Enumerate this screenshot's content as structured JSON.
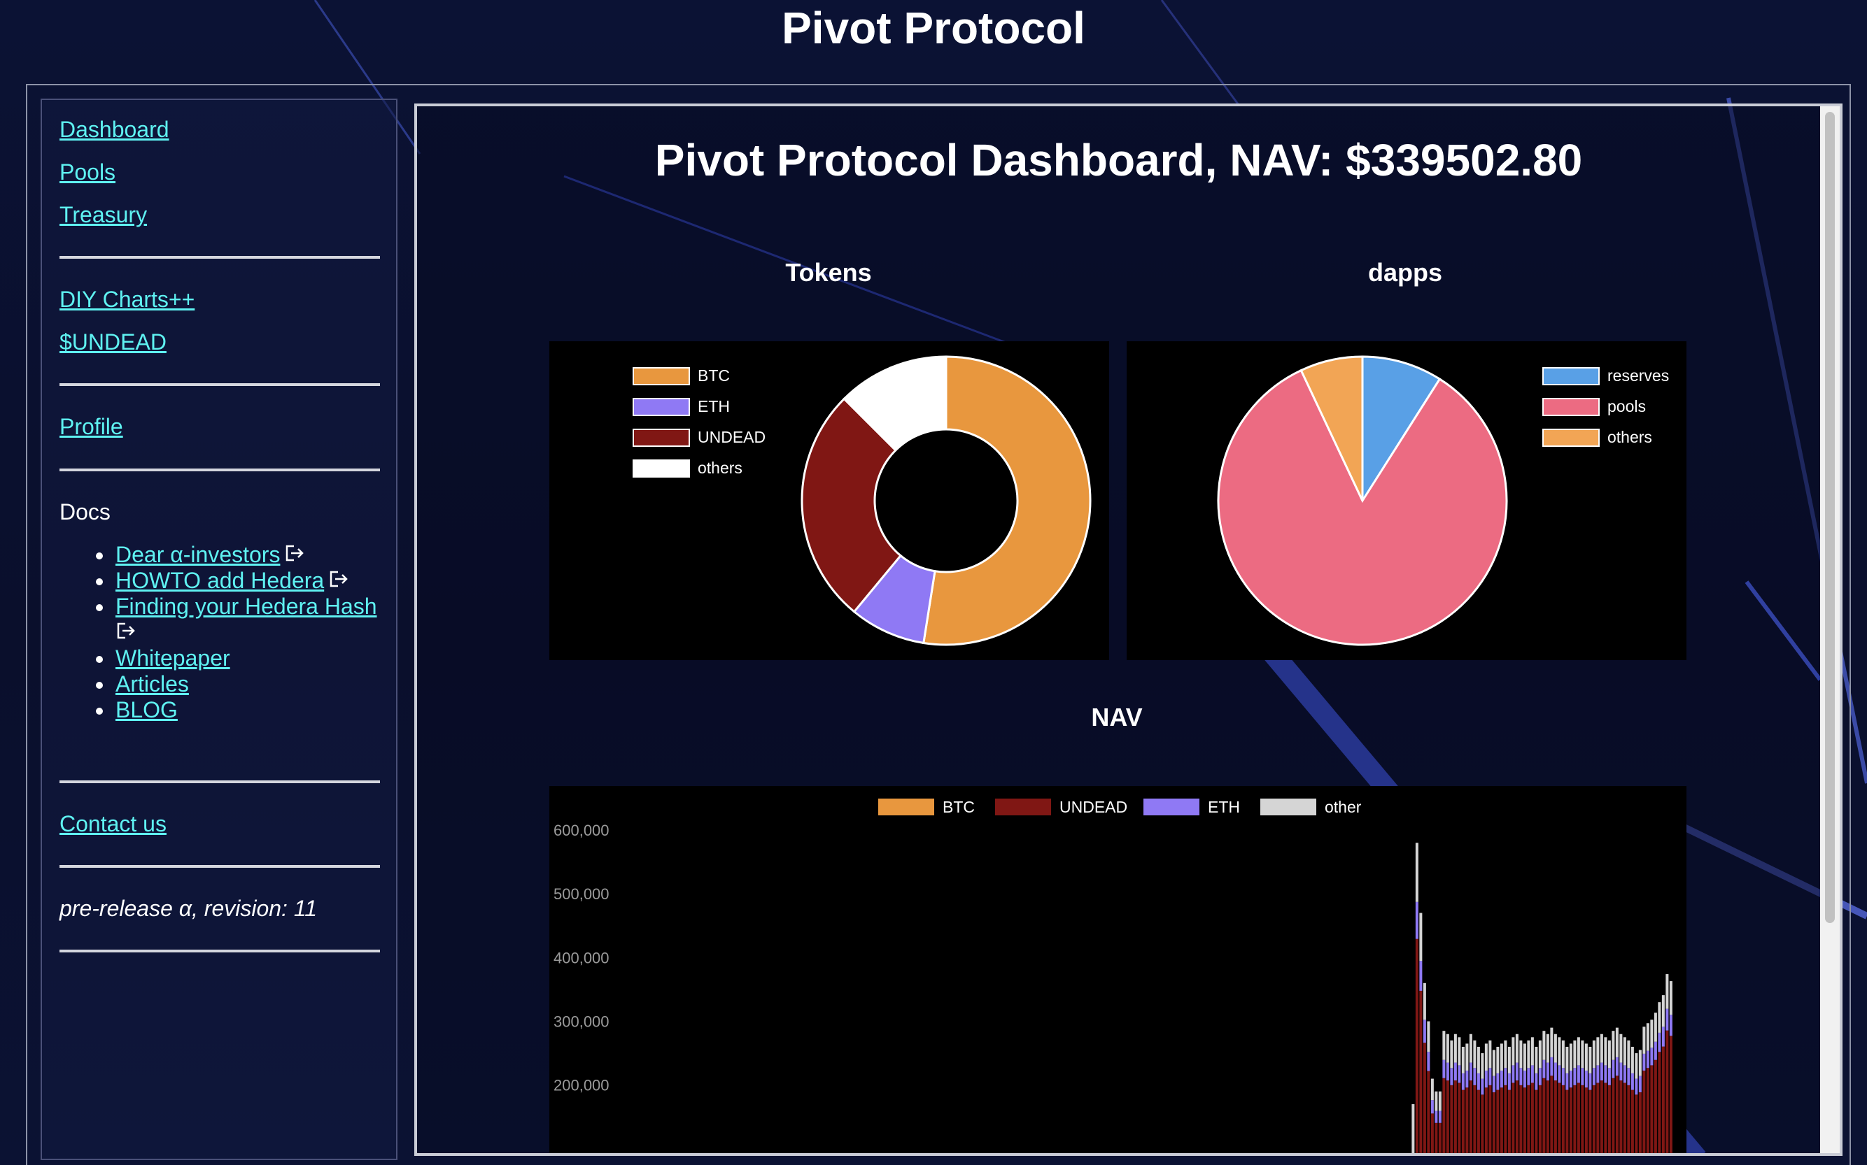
{
  "site_title": "Pivot Protocol",
  "sidebar": {
    "nav": [
      "Dashboard",
      "Pools",
      "Treasury"
    ],
    "tools": [
      "DIY Charts++",
      "$UNDEAD"
    ],
    "profile": "Profile",
    "docs_heading": "Docs",
    "docs": [
      {
        "label": "Dear α-investors",
        "external": true
      },
      {
        "label": "HOWTO add Hedera",
        "external": true
      },
      {
        "label": "Finding your Hedera Hash",
        "external": true
      },
      {
        "label": "Whitepaper",
        "external": false
      },
      {
        "label": "Articles",
        "external": false
      },
      {
        "label": "BLOG",
        "external": false
      }
    ],
    "contact": "Contact us",
    "revision": "pre-release α, revision: 11"
  },
  "main": {
    "title": "Pivot Protocol Dashboard, NAV: $339502.80",
    "tokens_title": "Tokens",
    "dapps_title": "dapps",
    "nav_title": "NAV"
  },
  "colors": {
    "btc": "#E8973E",
    "eth": "#8F79F4",
    "undead": "#801714",
    "others": "#FFFFFF",
    "reserves": "#59A0E6",
    "pools": "#EC6B82",
    "dapps_others": "#F2A555",
    "other": "#D5D5D5",
    "link": "#5FF2F2"
  },
  "chart_data": [
    {
      "type": "pie",
      "variant": "doughnut",
      "title": "Tokens",
      "legend_position": "top-left",
      "labels": [
        "BTC",
        "ETH",
        "UNDEAD",
        "others"
      ],
      "values": [
        52.5,
        8.5,
        26.5,
        12.5
      ],
      "colors": [
        "#E8973E",
        "#8F79F4",
        "#801714",
        "#FFFFFF"
      ]
    },
    {
      "type": "pie",
      "title": "dapps",
      "legend_position": "top-right",
      "labels": [
        "reserves",
        "pools",
        "others"
      ],
      "values": [
        9,
        84,
        7
      ],
      "colors": [
        "#59A0E6",
        "#EC6B82",
        "#F2A555"
      ]
    },
    {
      "type": "bar",
      "stacked": true,
      "title": "NAV",
      "legend_position": "top",
      "y_ticks": [
        "600,000",
        "500,000",
        "400,000",
        "300,000",
        "200,000"
      ],
      "ylim": [
        0,
        600000
      ],
      "grid": false,
      "series_order": [
        "BTC",
        "UNDEAD",
        "ETH",
        "other"
      ],
      "legend": [
        {
          "name": "BTC",
          "color": "#E8973E"
        },
        {
          "name": "UNDEAD",
          "color": "#801714"
        },
        {
          "name": "ETH",
          "color": "#8F79F4"
        },
        {
          "name": "other",
          "color": "#D5D5D5"
        }
      ],
      "visible_x_fraction_start": 0.755,
      "totals": [
        70000,
        170000,
        580000,
        470000,
        360000,
        300000,
        210000,
        190000,
        190000,
        285000,
        280000,
        270000,
        280000,
        275000,
        260000,
        265000,
        280000,
        270000,
        260000,
        250000,
        265000,
        270000,
        255000,
        260000,
        265000,
        270000,
        260000,
        275000,
        280000,
        270000,
        265000,
        270000,
        275000,
        260000,
        270000,
        285000,
        280000,
        290000,
        280000,
        275000,
        270000,
        260000,
        265000,
        270000,
        275000,
        270000,
        265000,
        260000,
        270000,
        275000,
        280000,
        275000,
        270000,
        285000,
        290000,
        280000,
        275000,
        270000,
        260000,
        250000,
        255000,
        265000,
        270000,
        275000,
        285000,
        300000,
        310000,
        340000,
        330000
      ]
    }
  ]
}
